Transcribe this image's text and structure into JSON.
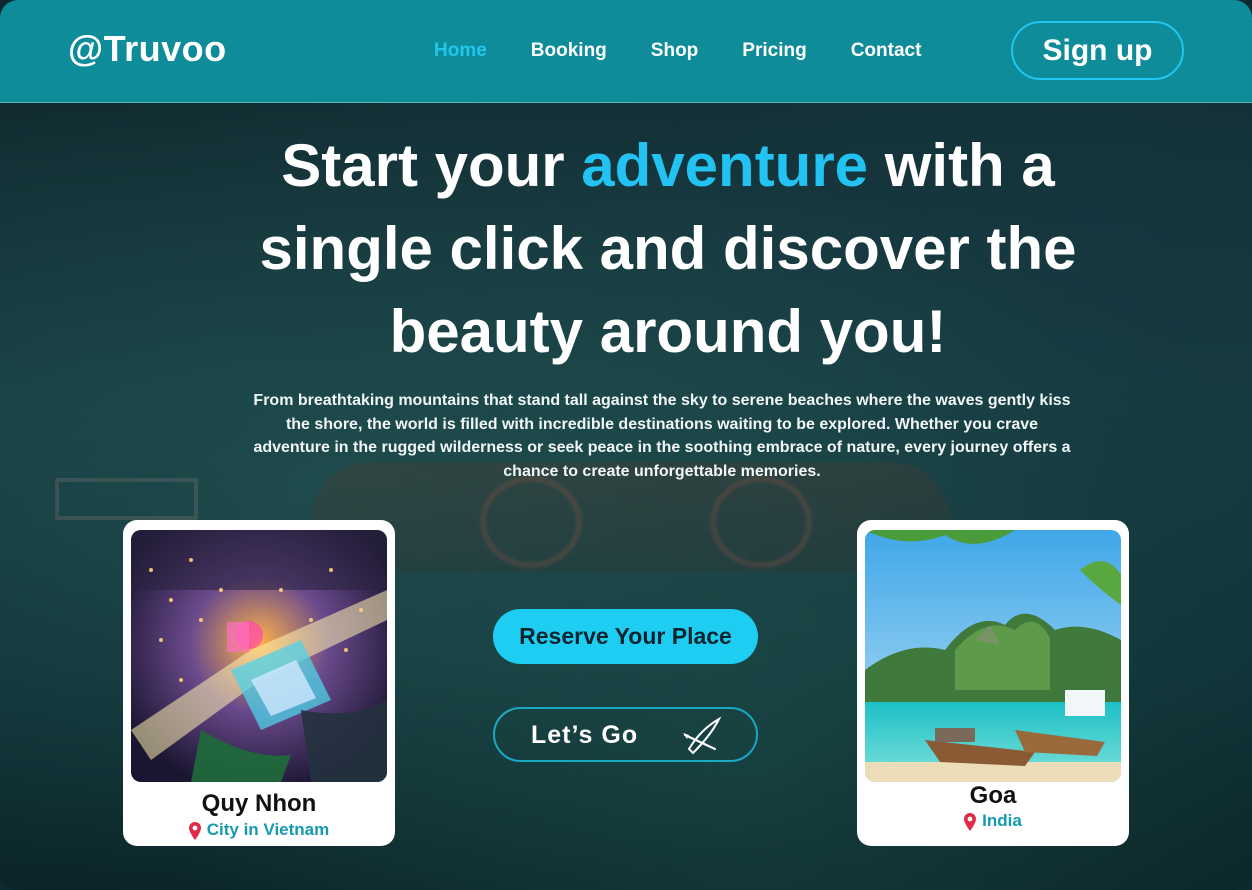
{
  "brand": {
    "logo": "@Truvoo"
  },
  "nav": {
    "items": [
      {
        "label": "Home",
        "active": true
      },
      {
        "label": "Booking",
        "active": false
      },
      {
        "label": "Shop",
        "active": false
      },
      {
        "label": "Pricing",
        "active": false
      },
      {
        "label": "Contact",
        "active": false
      }
    ],
    "signup_label": "Sign up"
  },
  "hero": {
    "headline_pre": "Start your ",
    "headline_accent": "adventure",
    "headline_post": " with a single click and discover the beauty around you!",
    "paragraph": "From breathtaking mountains that stand tall against the sky to serene beaches where the waves gently kiss the shore, the world is filled with incredible destinations waiting to be explored. Whether you crave adventure in the rugged wilderness or seek peace in the soothing embrace of nature, every journey offers a chance to create unforgettable memories."
  },
  "actions": {
    "reserve_label": "Reserve Your Place",
    "go_label": "Let’s Go"
  },
  "cards": [
    {
      "title": "Quy Nhon",
      "subtitle": "City in Vietnam"
    },
    {
      "title": "Goa",
      "subtitle": "India"
    }
  ],
  "colors": {
    "navbar": "#0e8c99",
    "accent": "#22c3f2",
    "reserve_button": "#1ecdf2",
    "pin": "#e02a47",
    "subtitle": "#159ab0"
  },
  "icons": [
    "location-pin-icon",
    "kayak-icon"
  ]
}
